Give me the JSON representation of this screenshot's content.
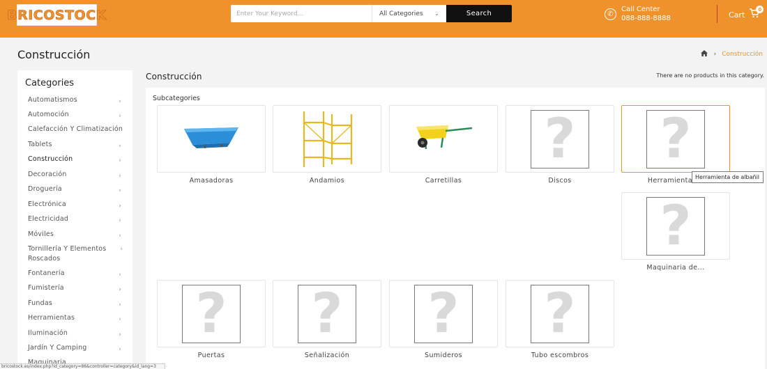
{
  "header": {
    "logo_text": "BRICOSTOCK",
    "search_placeholder": "Enter Your Keyword...",
    "category_select": "All Categories",
    "search_button": "Search",
    "call_center_label": "Call Center",
    "call_center_phone": "088-888-8888",
    "cart_label": "Cart",
    "cart_count": "0"
  },
  "page": {
    "title": "Construcción",
    "breadcrumb_current": "Construcción"
  },
  "sidebar": {
    "title": "Categories",
    "items": [
      {
        "label": "Automatismos"
      },
      {
        "label": "Automoción"
      },
      {
        "label": "Calefacción Y Climatización"
      },
      {
        "label": "Tablets"
      },
      {
        "label": "Construcción"
      },
      {
        "label": "Decoración"
      },
      {
        "label": "Droguería"
      },
      {
        "label": "Electrónica"
      },
      {
        "label": "Electricidad"
      },
      {
        "label": "Móviles"
      },
      {
        "label": "Tornillería Y Elementos Roscados"
      },
      {
        "label": "Fontanería"
      },
      {
        "label": "Fumistería"
      },
      {
        "label": "Fundas"
      },
      {
        "label": "Herramientas"
      },
      {
        "label": "Iluminación"
      },
      {
        "label": "Jardín Y Camping"
      },
      {
        "label": "Maquinaria"
      }
    ]
  },
  "main": {
    "title": "Construcción",
    "no_products": "There are no products in this category.",
    "subcategories_heading": "Subcategories",
    "subcategories": [
      {
        "label": "Amasadoras",
        "icon": "mixing-trough-icon"
      },
      {
        "label": "Andamios",
        "icon": "scaffold-icon"
      },
      {
        "label": "Carretillas",
        "icon": "wheelbarrow-icon"
      },
      {
        "label": "Discos",
        "icon": "placeholder-question-icon"
      },
      {
        "label": "Herramienta de",
        "icon": "placeholder-question-icon"
      },
      {
        "label": "Maquinaria de...",
        "icon": "placeholder-question-icon"
      },
      {
        "label": "Puertas",
        "icon": "placeholder-question-icon"
      },
      {
        "label": "Señalización",
        "icon": "placeholder-question-icon"
      },
      {
        "label": "Sumideros",
        "icon": "placeholder-question-icon"
      },
      {
        "label": "Tubo escombros",
        "icon": "placeholder-question-icon"
      }
    ],
    "tooltip": "Herramienta de albañil"
  },
  "status_bar": "bricostock.es/index.php?id_category=86&controller=category&id_lang=3",
  "colors": {
    "brand_orange": "#f0922c",
    "search_button_bg": "#111111",
    "divider_red": "#c43b1b"
  }
}
